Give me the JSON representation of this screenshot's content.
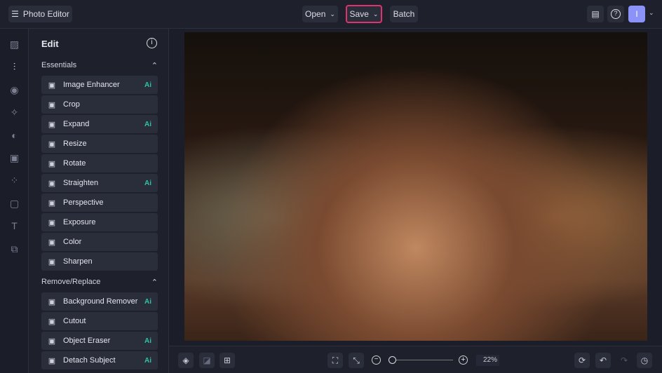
{
  "header": {
    "app_title": "Photo Editor",
    "open": "Open",
    "save": "Save",
    "batch": "Batch",
    "avatar": "I"
  },
  "panel": {
    "title": "Edit",
    "sections": [
      {
        "label": "Essentials",
        "items": [
          {
            "label": "Image Enhancer",
            "ai": "Ai",
            "icon": "image-enhancer-icon"
          },
          {
            "label": "Crop",
            "ai": "",
            "icon": "crop-icon"
          },
          {
            "label": "Expand",
            "ai": "Ai",
            "icon": "expand-icon"
          },
          {
            "label": "Resize",
            "ai": "",
            "icon": "resize-icon"
          },
          {
            "label": "Rotate",
            "ai": "",
            "icon": "rotate-icon"
          },
          {
            "label": "Straighten",
            "ai": "Ai",
            "icon": "straighten-icon"
          },
          {
            "label": "Perspective",
            "ai": "",
            "icon": "perspective-icon"
          },
          {
            "label": "Exposure",
            "ai": "",
            "icon": "exposure-icon"
          },
          {
            "label": "Color",
            "ai": "",
            "icon": "color-icon"
          },
          {
            "label": "Sharpen",
            "ai": "",
            "icon": "sharpen-icon"
          }
        ]
      },
      {
        "label": "Remove/Replace",
        "items": [
          {
            "label": "Background Remover",
            "ai": "Ai",
            "icon": "background-remover-icon"
          },
          {
            "label": "Cutout",
            "ai": "",
            "icon": "cutout-icon"
          },
          {
            "label": "Object Eraser",
            "ai": "Ai",
            "icon": "object-eraser-icon"
          },
          {
            "label": "Detach Subject",
            "ai": "Ai",
            "icon": "detach-subject-icon"
          }
        ]
      }
    ]
  },
  "footer": {
    "zoom": "22%",
    "zoom_fraction": 0.05
  },
  "colors": {
    "accent": "#8b93f8",
    "highlight": "#e0336e",
    "ai": "#2fc3a6"
  }
}
